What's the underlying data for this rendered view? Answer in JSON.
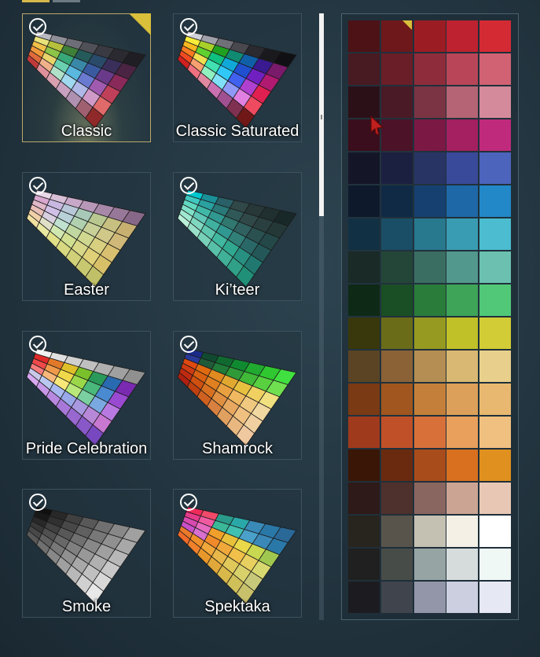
{
  "top_tabs": [
    {
      "color": "#d6b84a"
    },
    {
      "color": "#6c7a84"
    }
  ],
  "palettes": [
    {
      "label": "Classic",
      "selected": true,
      "owned": true,
      "rows": [
        [
          "#b8b8c2",
          "#8f8f9a",
          "#6e6e78",
          "#505058",
          "#3a3a42",
          "#2a2a30",
          "#1e1e24"
        ],
        [
          "#e8e27a",
          "#b6c03c",
          "#3e7f3a",
          "#245a5a",
          "#2a4a6a",
          "#3a2e5a",
          "#4a2442"
        ],
        [
          "#f0c04a",
          "#8cc448",
          "#38a878",
          "#3a88a8",
          "#3a5aa0",
          "#6a3a8a",
          "#8a2a5a"
        ],
        [
          "#f0983a",
          "#e8d46a",
          "#6ad0b0",
          "#5ab8e0",
          "#6a7ad0",
          "#a05ab0",
          "#c0405a"
        ],
        [
          "#e06a3a",
          "#f0b08a",
          "#b0e0c8",
          "#a0d8f0",
          "#b0b8e8",
          "#d09ac8",
          "#e06a6a"
        ],
        [
          "#c03a3a",
          "#e0909a",
          "#d8a0b0",
          "#c8a0c0",
          "#b090b0",
          "#a06070",
          "#902a2a"
        ]
      ]
    },
    {
      "label": "Classic Saturated",
      "selected": false,
      "owned": true,
      "rows": [
        [
          "#d0d0d8",
          "#a0a0aa",
          "#707078",
          "#48484e",
          "#2a2a30",
          "#1a1a1e",
          "#101014"
        ],
        [
          "#f8ec3a",
          "#a8d028",
          "#20a020",
          "#108a70",
          "#1060a8",
          "#3a1a90",
          "#7a1a6a"
        ],
        [
          "#f8b820",
          "#60d030",
          "#10c080",
          "#10a8d8",
          "#2050d0",
          "#7020c0",
          "#b01a70"
        ],
        [
          "#f87a20",
          "#f0e050",
          "#40e0b0",
          "#30c8f8",
          "#4060f0",
          "#b040d0",
          "#e02050"
        ],
        [
          "#f04a20",
          "#f8a070",
          "#90f0c0",
          "#80e0f8",
          "#9098f8",
          "#e080e0",
          "#f04a60"
        ],
        [
          "#d02020",
          "#f07080",
          "#e088a0",
          "#c870b0",
          "#a05090",
          "#803050",
          "#701818"
        ]
      ]
    },
    {
      "label": "Easter",
      "selected": false,
      "owned": true,
      "rows": [
        [
          "#e8d8e8",
          "#d8c0d8",
          "#c8a8c8",
          "#b898b8",
          "#a888a8",
          "#987898",
          "#886888"
        ],
        [
          "#d8a8d0",
          "#c8b8e0",
          "#b8c8d8",
          "#a8c8b8",
          "#b8c890",
          "#c8c080",
          "#c8b070"
        ],
        [
          "#e0b8c8",
          "#d0c0e8",
          "#b8d0d8",
          "#b0d0b0",
          "#c8d098",
          "#d0c888",
          "#d0b878"
        ],
        [
          "#e8c0b8",
          "#d8d0e0",
          "#c0e0d0",
          "#c0d8a0",
          "#d0d890",
          "#d8d080",
          "#d8c070"
        ],
        [
          "#f0d0a8",
          "#e0e0c8",
          "#d0e8b0",
          "#d0e090",
          "#d8d888",
          "#e0d078",
          "#d8c068"
        ],
        [
          "#f0e0a0",
          "#e8e8a0",
          "#e0e088",
          "#d8d880",
          "#d0d078",
          "#c8c870",
          "#c0c068"
        ]
      ]
    },
    {
      "label": "Ki’teer",
      "selected": false,
      "owned": true,
      "rows": [
        [
          "#00c8d0",
          "#1a9098",
          "#2a6068",
          "#304848",
          "#283838",
          "#203030",
          "#182828"
        ],
        [
          "#40c8c0",
          "#2aa0a0",
          "#2a7878",
          "#305858",
          "#304848",
          "#2a4040",
          "#243838"
        ],
        [
          "#60d8c0",
          "#40b8a8",
          "#309890",
          "#307870",
          "#306060",
          "#2a5050",
          "#244848"
        ],
        [
          "#80e0c8",
          "#60c8b8",
          "#40b0a0",
          "#309890",
          "#308078",
          "#2a6868",
          "#245858"
        ],
        [
          "#a0e8d0",
          "#80d8c0",
          "#60c8b0",
          "#40b8a0",
          "#30a890",
          "#289080",
          "#207870"
        ],
        [
          "#b8f0d8",
          "#98e0c8",
          "#78d0b8",
          "#58c0a8",
          "#40b098",
          "#30a088",
          "#209078"
        ]
      ]
    },
    {
      "label": "Pride Celebration",
      "selected": false,
      "owned": true,
      "rows": [
        [
          "#f0f0f0",
          "#e0e0e0",
          "#d0d0d0",
          "#c0c0c0",
          "#b0b0b0",
          "#a0a0a0",
          "#909090"
        ],
        [
          "#e02a2a",
          "#e07a2a",
          "#e0c02a",
          "#7ac02a",
          "#2a9a5a",
          "#2a6ab0",
          "#7a2ab0"
        ],
        [
          "#f04a4a",
          "#f09a4a",
          "#f0d84a",
          "#9ad84a",
          "#4ab87a",
          "#4a8ad0",
          "#9a4ad0"
        ],
        [
          "#f87a7a",
          "#f8b87a",
          "#f8e87a",
          "#b8e87a",
          "#7ad0a0",
          "#7aa8e0",
          "#b87ae0"
        ],
        [
          "#c8c8e8",
          "#b8c8f0",
          "#a8b8f0",
          "#98a8e8",
          "#a898e0",
          "#b888d8",
          "#c878d0"
        ],
        [
          "#d8a8f0",
          "#c898e8",
          "#b888e0",
          "#a878d8",
          "#9868d0",
          "#8858c8",
          "#7848c0"
        ]
      ]
    },
    {
      "label": "Shamrock",
      "selected": false,
      "owned": true,
      "rows": [
        [
          "#1a2a8a",
          "#104a30",
          "#106a30",
          "#108a30",
          "#20aa30",
          "#30c830",
          "#40e040"
        ],
        [
          "#2a3a9a",
          "#205a38",
          "#207a38",
          "#309a38",
          "#40b838",
          "#58d040",
          "#70e050"
        ],
        [
          "#e04a10",
          "#e06a10",
          "#e08a20",
          "#e0a830",
          "#e8c040",
          "#f0d060",
          "#f0e080"
        ],
        [
          "#d03a10",
          "#d86010",
          "#e08020",
          "#e8a040",
          "#f0b860",
          "#f0c880",
          "#f0d8a0"
        ],
        [
          "#c02a10",
          "#d05010",
          "#d87020",
          "#e09040",
          "#e8a860",
          "#f0c080",
          "#f0d0a0"
        ],
        [
          "#b02010",
          "#c04010",
          "#d06020",
          "#d88040",
          "#e0a060",
          "#e8b880",
          "#f0c8a0"
        ]
      ]
    },
    {
      "label": "Smoke",
      "selected": false,
      "owned": true,
      "rows": [
        [
          "#101010",
          "#282828",
          "#404040",
          "#585858",
          "#707070",
          "#888888",
          "#a0a0a0"
        ],
        [
          "#181818",
          "#303030",
          "#484848",
          "#606060",
          "#787878",
          "#909090",
          "#a8a8a8"
        ],
        [
          "#282828",
          "#404040",
          "#585858",
          "#707070",
          "#888888",
          "#a0a0a0",
          "#b8b8b8"
        ],
        [
          "#383838",
          "#505050",
          "#686868",
          "#808080",
          "#989898",
          "#b0b0b0",
          "#c8c8c8"
        ],
        [
          "#484848",
          "#606060",
          "#787878",
          "#909090",
          "#a8a8a8",
          "#c0c0c0",
          "#d8d8d8"
        ],
        [
          "#585858",
          "#707070",
          "#888888",
          "#a0a0a0",
          "#b8b8b8",
          "#d0d0d0",
          "#e8e8e8"
        ]
      ]
    },
    {
      "label": "Spektaka",
      "selected": false,
      "owned": true,
      "rows": [
        [
          "#f02a5a",
          "#f04a6a",
          "#2a9a8a",
          "#2aa8a8",
          "#3a8ab8",
          "#2a78a8",
          "#2a6898"
        ],
        [
          "#e83a8a",
          "#f05aa0",
          "#3ab898",
          "#40c0b0",
          "#4aa0c8",
          "#3a88b8",
          "#2a78a8"
        ],
        [
          "#d84ab0",
          "#e86ac0",
          "#f0a02a",
          "#e8c03a",
          "#e8d84a",
          "#c8d850",
          "#a0c850"
        ],
        [
          "#c850c8",
          "#d870d0",
          "#f08a2a",
          "#f0a83a",
          "#f0c04a",
          "#e8d060",
          "#d8d870"
        ],
        [
          "#e87a2a",
          "#f0902a",
          "#f0a83a",
          "#e8b84a",
          "#e0c85a",
          "#d8d06a",
          "#c8c87a"
        ],
        [
          "#f06a2a",
          "#f0802a",
          "#e8982a",
          "#e0a83a",
          "#d8b84a",
          "#d0c05a",
          "#c8c06a"
        ]
      ]
    }
  ],
  "swatch_grid": [
    [
      "#4c1216",
      "#6e181c",
      "#9c1c24",
      "#be2230",
      "#d42a34"
    ],
    [
      "#481a22",
      "#6a1e28",
      "#8e2c3c",
      "#b84658",
      "#d06274"
    ],
    [
      "#2c1018",
      "#4a1a26",
      "#7a3444",
      "#b46474",
      "#d48a9a"
    ],
    [
      "#3a0e1c",
      "#4c1228",
      "#7c1844",
      "#a42060",
      "#c02a7c"
    ],
    [
      "#141628",
      "#1c2040",
      "#283464",
      "#3a4a9a",
      "#4c64bc"
    ],
    [
      "#0e1a2c",
      "#102a46",
      "#164070",
      "#1e68a8",
      "#2288c8"
    ],
    [
      "#123044",
      "#1a4e66",
      "#28788e",
      "#3a9cb2",
      "#4cbcd0"
    ],
    [
      "#1a2a26",
      "#244638",
      "#3a6e62",
      "#52988c",
      "#6cc0b0"
    ],
    [
      "#0e2a16",
      "#1a4e24",
      "#2a7c3a",
      "#3ea458",
      "#50c878"
    ],
    [
      "#38380c",
      "#6a6c18",
      "#969a20",
      "#c0c028",
      "#d2cc36"
    ],
    [
      "#5a4424",
      "#8a6236",
      "#b48e52",
      "#d8b872",
      "#e8d08c"
    ],
    [
      "#7a3a14",
      "#a0561e",
      "#c4803a",
      "#dca05a",
      "#e8b870"
    ],
    [
      "#a03a1c",
      "#c05028",
      "#d8703a",
      "#e8a05c",
      "#f0c080"
    ],
    [
      "#3a1606",
      "#6a2a10",
      "#a84c1c",
      "#d87020",
      "#e0901e"
    ],
    [
      "#2e1a18",
      "#4e302c",
      "#8a6660",
      "#cca494",
      "#e8c8b4"
    ],
    [
      "#28241e",
      "#58544c",
      "#c4c0b2",
      "#f4f0e6",
      "#ffffff"
    ],
    [
      "#202020",
      "#484c48",
      "#96a4a4",
      "#d6dcdc",
      "#f0f8f6"
    ],
    [
      "#1c1c20",
      "#40444c",
      "#9296a8",
      "#cccfe0",
      "#e6e8f4"
    ]
  ]
}
